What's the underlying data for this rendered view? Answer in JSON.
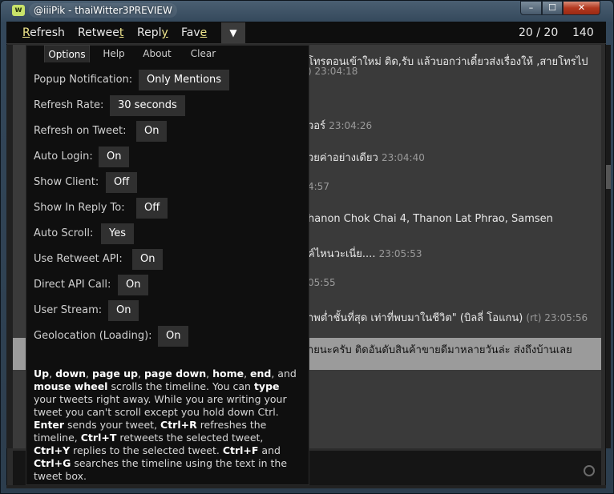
{
  "window": {
    "title": "@iiiPik - thaiWitter3PREVIEW",
    "app_icon": "w",
    "controls": {
      "minimize": "–",
      "maximize": "☐",
      "close": "✕"
    }
  },
  "menu": {
    "refresh": {
      "accel": "R",
      "rest": "efresh"
    },
    "retweet": {
      "pre": "Retwee",
      "accel": "t"
    },
    "reply": {
      "pre": "Repl",
      "accel": "y"
    },
    "fave": {
      "pre": "Fav",
      "accel": "e"
    },
    "arrow": "▼",
    "position": "20 / 20",
    "chars_left": "140"
  },
  "tabs": [
    "Options",
    "Help",
    "About",
    "Clear"
  ],
  "options": [
    {
      "label": "Popup Notification:",
      "value": "Only Mentions"
    },
    {
      "label": "Refresh Rate:",
      "value": "30 seconds"
    },
    {
      "label": "Refresh on Tweet:",
      "value": "On"
    },
    {
      "label": "Auto Login:",
      "value": "On"
    },
    {
      "label": "Show Client:",
      "value": "Off"
    },
    {
      "label": "Show In Reply To:",
      "value": "Off"
    },
    {
      "label": "Auto Scroll:",
      "value": "Yes"
    },
    {
      "label": "Use Retweet API:",
      "value": "On"
    },
    {
      "label": "Direct API Call:",
      "value": "On"
    },
    {
      "label": "User Stream:",
      "value": "On"
    },
    {
      "label": "Geolocation (Loading):",
      "value": "On"
    }
  ],
  "help": {
    "k1": "Up",
    "t1": ", ",
    "k2": "down",
    "t2": ", ",
    "k3": "page up",
    "t3": ", ",
    "k4": "page down",
    "t4": ", ",
    "k5": "home",
    "t5": ", ",
    "k6": "end",
    "t6": ", and ",
    "k7": "mouse wheel",
    "t7": " scrolls the timeline. You can ",
    "k8": "type",
    "t8": " your tweets right away. While you are writing your tweet you can't scroll except you hold down Ctrl. ",
    "k9": "Enter",
    "t9": " sends your tweet, ",
    "k10": "Ctrl+R",
    "t10": " refreshes the timeline, ",
    "k11": "Ctrl+T",
    "t11": " retweets the selected tweet, ",
    "k12": "Ctrl+Y",
    "t12": " replies to the selected tweet. ",
    "k13": "Ctrl+F",
    "t13": " and ",
    "k14": "Ctrl+G",
    "t14": " searches the timeline using the text in the tweet box."
  },
  "timeline": [
    {
      "text": "โทรตอนเข้าใหม่ ติด,รับ แล้วบอกว่าเดี๋ยวส่งเรื่องให้ ,สายโทรไป",
      "time": ""
    },
    {
      "text": "",
      "time": ") 23:04:18"
    },
    {
      "text": "วอร์",
      "time": "23:04:26"
    },
    {
      "text": "วยค่าอย่างเดียว",
      "time": "23:04:40"
    },
    {
      "text": "",
      "time": "4:57"
    },
    {
      "text": "hanon Chok Chai 4, Thanon Lat Phrao, Samsen",
      "time": ""
    },
    {
      "text": "ค์ไหนวะเนี่ย....",
      "time": "23:05:53"
    },
    {
      "text": "",
      "time": "05:55"
    },
    {
      "text": "าพต่ำชั้นที่สุด เท่าที่พบมาในชีวิต\" (บิลลี่ โอแกน)",
      "time": "(rt) 23:05:56"
    },
    {
      "text": "ายนะครับ ติดอันดับสินค้าขายดีมาหลายวันล่ะ ส่งถึงบ้านเลย",
      "time": ""
    }
  ]
}
